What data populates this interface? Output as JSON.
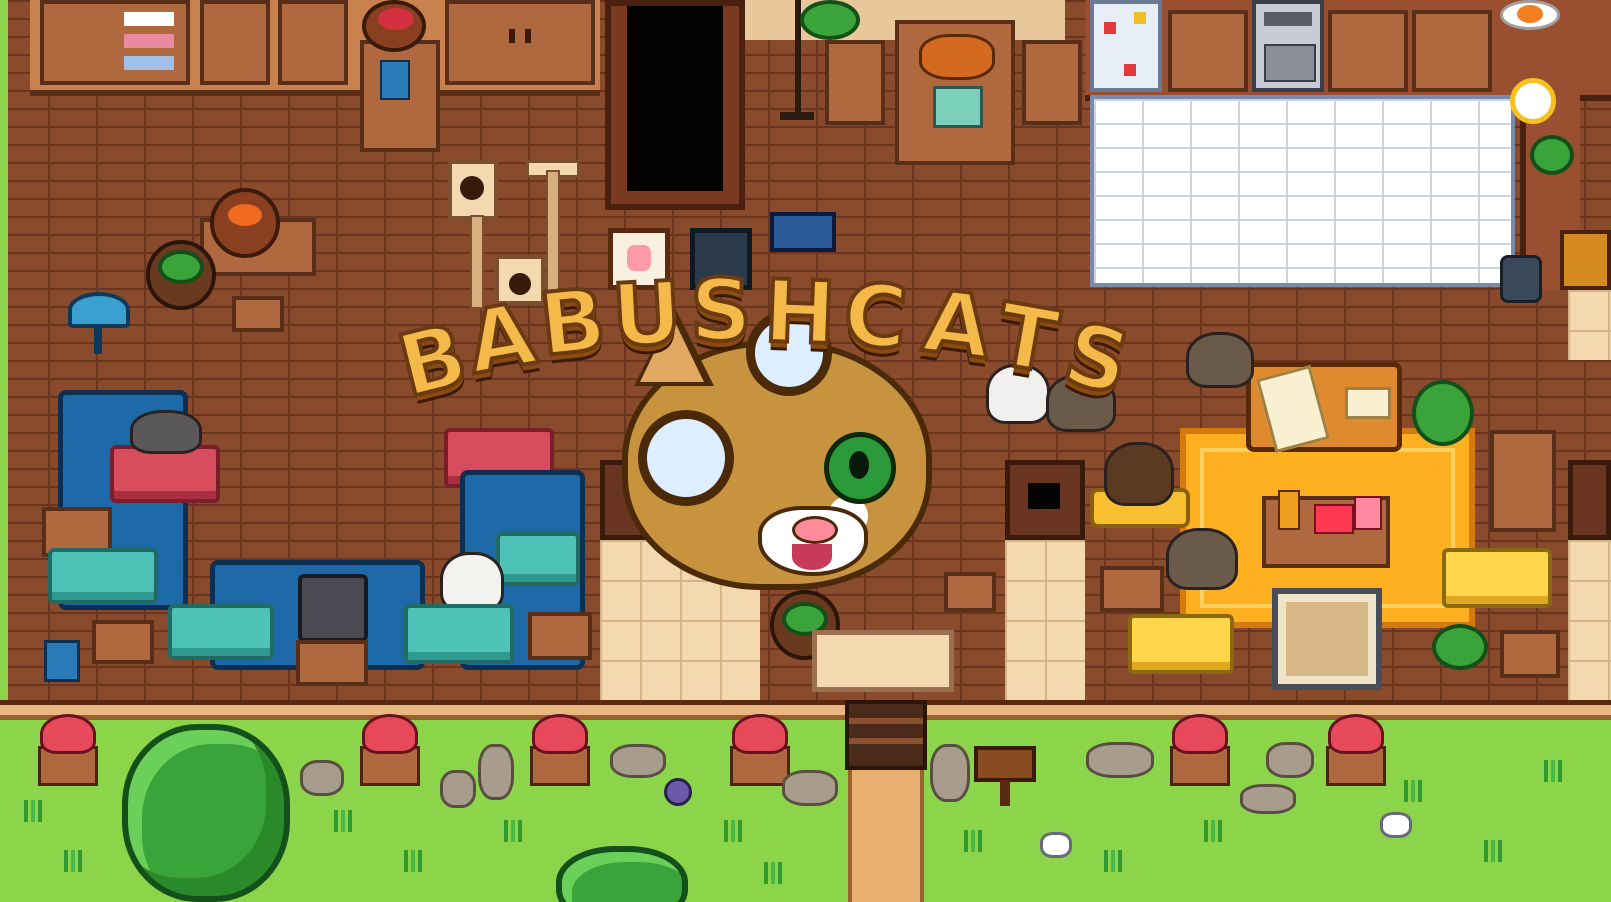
{
  "game": {
    "title_letters": [
      "B",
      "A",
      "B",
      "U",
      "S",
      "H",
      "C",
      "A",
      "T",
      "S"
    ],
    "title": "BABUSHCATS"
  },
  "colors": {
    "brick": "#8a4a2c",
    "grass": "#8cd44a",
    "title_fill": "#f5b94a",
    "title_outline": "#6a3a10",
    "teal_cushion": "#4fc2b8",
    "pink_cushion": "#d94c5e",
    "yellow_cushion": "#ffd54a",
    "rug": "#ffb020"
  },
  "icons": {
    "logo": "grandma-cat-with-glasses-icon",
    "cat_tree": "cat-tree-icon",
    "fridge": "fridge-icon",
    "stove": "stove-icon",
    "plant": "potted-plant-icon",
    "flower": "red-tulip-icon",
    "signpost": "wooden-sign-icon",
    "lamp": "table-lamp-icon"
  }
}
